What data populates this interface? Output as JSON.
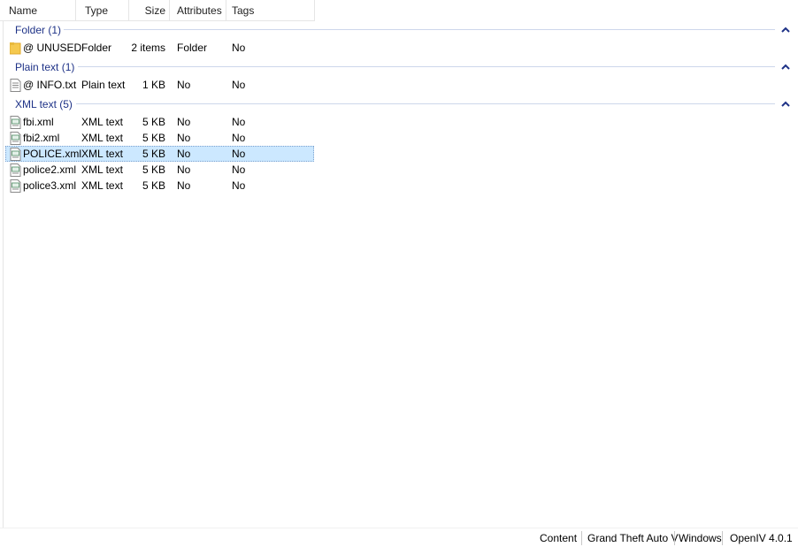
{
  "columns": {
    "name": "Name",
    "type": "Type",
    "size": "Size",
    "attributes": "Attributes",
    "tags": "Tags"
  },
  "groups": [
    {
      "label": "Folder (1)"
    },
    {
      "label": "Plain text (1)"
    },
    {
      "label": "XML text (5)"
    }
  ],
  "rows": [
    {
      "name": "@ UNUSED",
      "type": "Folder",
      "size": "2 items",
      "attributes": "Folder",
      "tags": "No",
      "icon": "folder-icon"
    },
    {
      "name": "@ INFO.txt",
      "type": "Plain text",
      "size": "1 KB",
      "attributes": "No",
      "tags": "No",
      "icon": "text-file-icon"
    },
    {
      "name": "fbi.xml",
      "type": "XML text",
      "size": "5 KB",
      "attributes": "No",
      "tags": "No",
      "icon": "xml-file-icon"
    },
    {
      "name": "fbi2.xml",
      "type": "XML text",
      "size": "5 KB",
      "attributes": "No",
      "tags": "No",
      "icon": "xml-file-icon"
    },
    {
      "name": "POLICE.xml",
      "type": "XML text",
      "size": "5 KB",
      "attributes": "No",
      "tags": "No",
      "icon": "xml-file-icon",
      "selected": true
    },
    {
      "name": "police2.xml",
      "type": "XML text",
      "size": "5 KB",
      "attributes": "No",
      "tags": "No",
      "icon": "xml-file-icon"
    },
    {
      "name": "police3.xml",
      "type": "XML text",
      "size": "5 KB",
      "attributes": "No",
      "tags": "No",
      "icon": "xml-file-icon"
    }
  ],
  "status": {
    "content": "Content",
    "game": "Grand Theft Auto V",
    "platform": "Windows",
    "app": "OpenIV 4.0.1"
  },
  "colors": {
    "group_text": "#1e3287",
    "selection": "#cce8ff",
    "folder": "#f5c94f"
  }
}
